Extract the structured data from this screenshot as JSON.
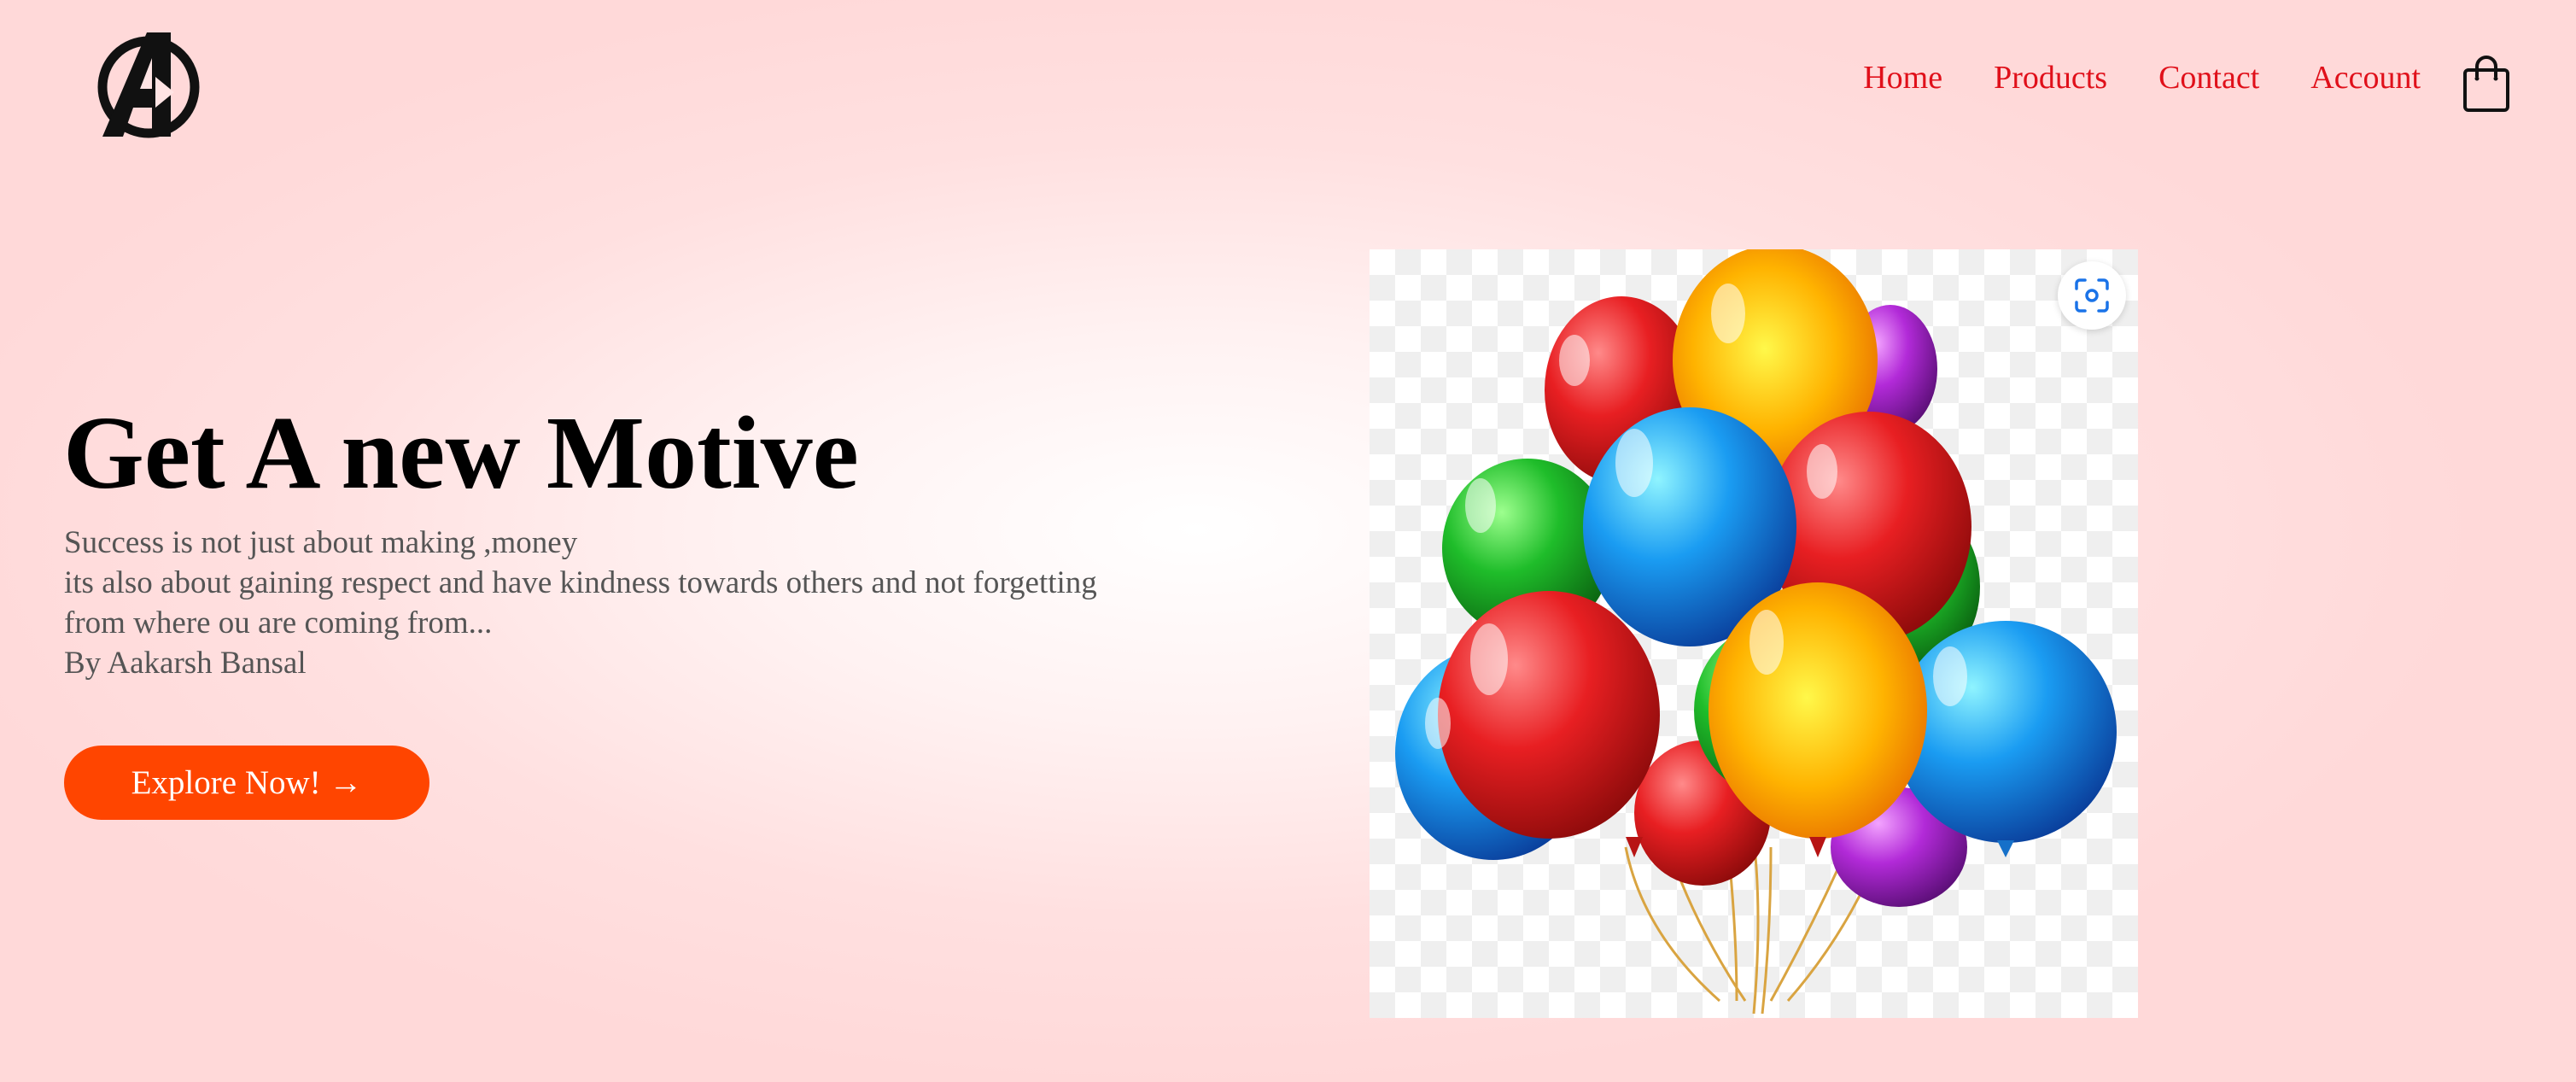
{
  "header": {
    "logo_icon": "avengers-a-logo-icon",
    "nav": [
      {
        "label": "Home"
      },
      {
        "label": "Products"
      },
      {
        "label": "Contact"
      },
      {
        "label": "Account"
      }
    ],
    "cart_icon": "shopping-bag-icon",
    "nav_color": "#e0101a"
  },
  "hero": {
    "title": "Get A new Motive",
    "lines": [
      "Success is not just about making ,money",
      "its also about gaining respect and have kindness towards others and not forgetting",
      "from where ou are coming from...",
      "By Aakarsh Bansal"
    ],
    "cta_label": "Explore Now! →",
    "cta_color": "#ff4500",
    "image_icon": "balloons-image",
    "lens_icon": "visual-search-icon"
  }
}
